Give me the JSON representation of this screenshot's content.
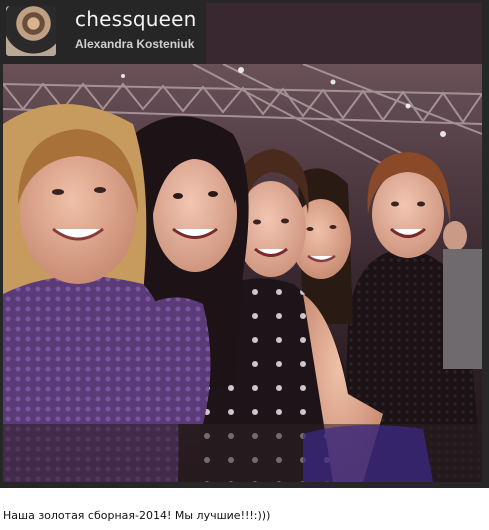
{
  "post": {
    "username": "chessqueen",
    "full_name": "Alexandra Kosteniuk",
    "caption": "Наша золотая сборная-2014! Мы лучшие!!!:)))"
  },
  "icons": {
    "avatar": "profile-photo",
    "photo": "group-selfie-photo"
  },
  "colors": {
    "card_background": "#272727",
    "header_accent": "#3a2830",
    "username_text": "#f3f3f3"
  }
}
